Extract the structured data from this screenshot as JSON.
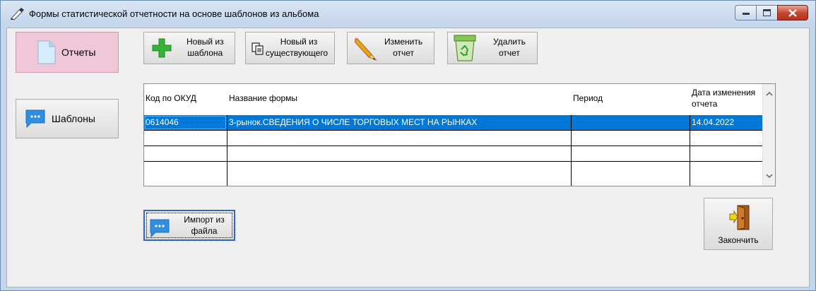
{
  "window": {
    "title": "Формы статистической отчетности на основе шаблонов из альбома",
    "minimize_icon": "minimize-icon",
    "maximize_icon": "maximize-icon",
    "close_icon": "close-icon"
  },
  "sidebar": {
    "reports_label": "Отчеты",
    "reports_icon": "document-icon",
    "templates_label": "Шаблоны",
    "templates_icon": "chat-bubble-icon",
    "reports_active_color": "#f0c6d9"
  },
  "toolbar": {
    "new_from_template": {
      "line1": "Новый из",
      "line2": "шаблона",
      "icon": "green-plus-icon"
    },
    "new_from_existing": {
      "line1": "Новый из",
      "line2": "существующего",
      "icon": "copy-documents-icon"
    },
    "edit_report": {
      "line1": "Изменить",
      "line2": "отчет",
      "icon": "pencil-icon"
    },
    "delete_report": {
      "line1": "Удалить",
      "line2": "отчет",
      "icon": "recycle-bin-icon"
    }
  },
  "table": {
    "columns": [
      "Код по ОКУД",
      "Название формы",
      "Период",
      "Дата изменения отчета"
    ],
    "rows": [
      {
        "code": "0614046",
        "name": "3-рынок.СВЕДЕНИЯ О ЧИСЛЕ ТОРГОВЫХ МЕСТ НА РЫНКАХ",
        "period": "",
        "date": "14.04.2022",
        "selected": true
      },
      {
        "code": "",
        "name": "",
        "period": "",
        "date": ""
      },
      {
        "code": "",
        "name": "",
        "period": "",
        "date": ""
      },
      {
        "code": "",
        "name": "",
        "period": "",
        "date": ""
      }
    ],
    "selection_color": "#0078d7"
  },
  "import_button": {
    "line1": "Импорт из",
    "line2": "файла",
    "icon": "chat-bubble-icon"
  },
  "finish_button": {
    "label": "Закончить",
    "icon": "exit-door-icon"
  }
}
